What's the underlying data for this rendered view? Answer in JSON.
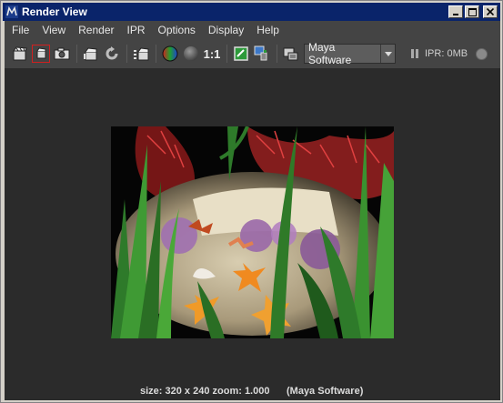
{
  "window": {
    "title": "Render View",
    "buttons": [
      "minimize",
      "maximize",
      "close"
    ]
  },
  "menu": {
    "items": [
      "File",
      "View",
      "Render",
      "IPR",
      "Options",
      "Display",
      "Help"
    ]
  },
  "toolbar": {
    "tools": [
      {
        "icon": "redo-render-icon"
      },
      {
        "icon": "render-region-icon",
        "selected": true
      },
      {
        "icon": "snapshot-icon"
      },
      {
        "icon": "ipr-render-icon"
      },
      {
        "icon": "refresh-ipr-icon"
      },
      {
        "icon": "render-sequence-icon"
      },
      {
        "icon": "rgb-channels-icon"
      },
      {
        "icon": "alpha-channel-icon"
      },
      {
        "icon": "keep-image-icon"
      },
      {
        "icon": "remove-image-icon"
      },
      {
        "icon": "render-settings-icon"
      }
    ],
    "ratio_label": "1:1",
    "renderer": "Maya Software",
    "ipr_label": "IPR: 0MB"
  },
  "status": {
    "size_zoom": "size: 320 x 240 zoom: 1.000",
    "renderer": "(Maya Software)"
  },
  "colors": {
    "title_bar": "#0a246a",
    "panel": "#444444",
    "viewport": "#2b2b2b",
    "selected_outline": "#d02020"
  }
}
